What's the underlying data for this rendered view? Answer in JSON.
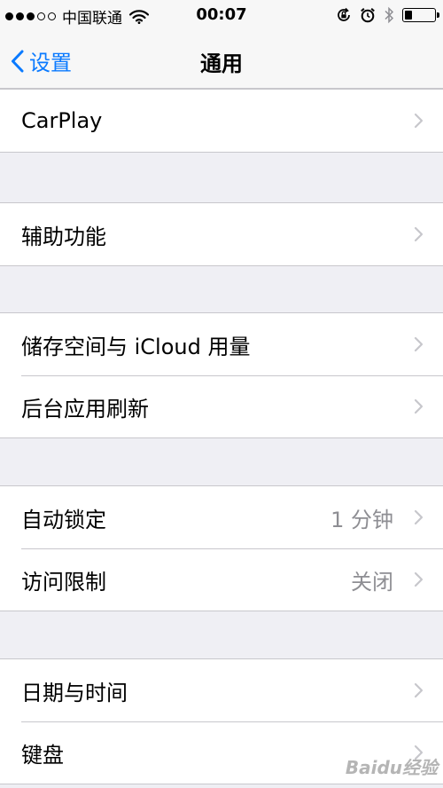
{
  "status_bar": {
    "carrier": "中国联通",
    "time": "00:07",
    "signal_bars_filled": 3,
    "signal_bars_total": 5,
    "battery_level": 0.25,
    "icons": [
      "wifi-icon",
      "orientation-lock-icon",
      "alarm-icon",
      "bluetooth-icon",
      "battery-icon"
    ]
  },
  "nav": {
    "back_label": "设置",
    "title": "通用"
  },
  "groups": [
    {
      "rows": [
        {
          "label": "CarPlay",
          "value": ""
        }
      ]
    },
    {
      "rows": [
        {
          "label": "辅助功能",
          "value": ""
        }
      ]
    },
    {
      "rows": [
        {
          "label": "储存空间与 iCloud 用量",
          "value": ""
        },
        {
          "label": "后台应用刷新",
          "value": ""
        }
      ]
    },
    {
      "rows": [
        {
          "label": "自动锁定",
          "value": "1 分钟"
        },
        {
          "label": "访问限制",
          "value": "关闭"
        }
      ]
    },
    {
      "rows": [
        {
          "label": "日期与时间",
          "value": ""
        },
        {
          "label": "键盘",
          "value": ""
        }
      ]
    }
  ],
  "watermark": "Baidu经验",
  "colors": {
    "accent": "#0a7aff",
    "background": "#efeff4",
    "separator": "#c8c7cc",
    "secondary_text": "#8e8e93"
  }
}
